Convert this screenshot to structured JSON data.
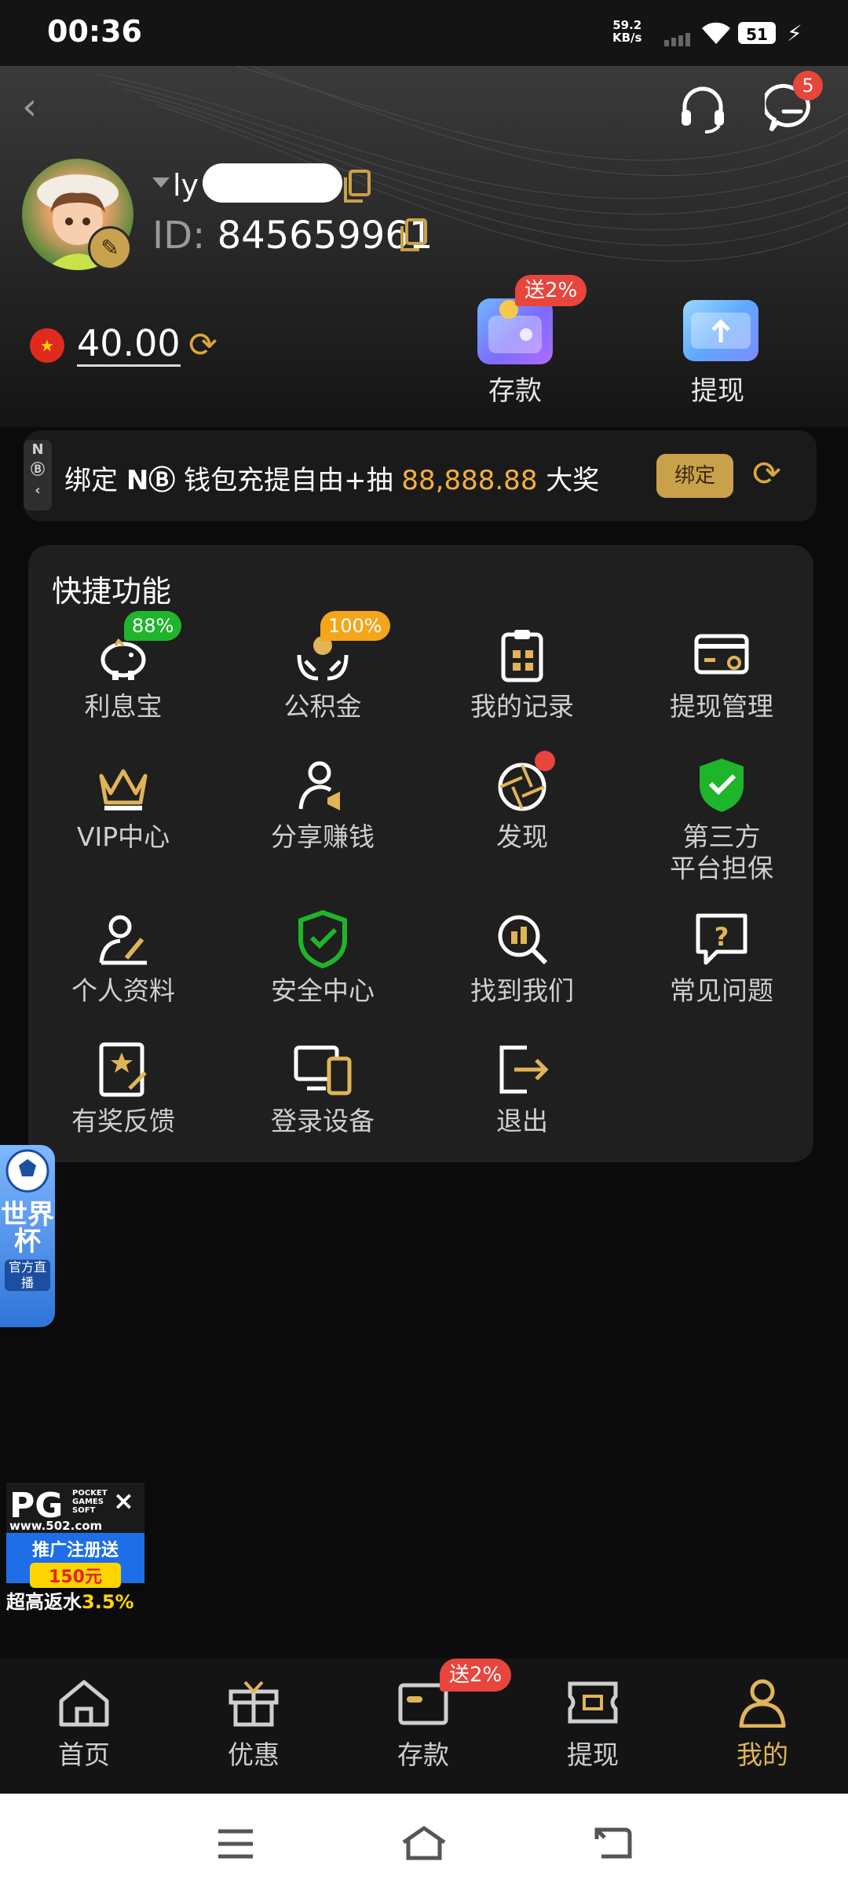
{
  "status_bar": {
    "time": "00:36",
    "net_speed_value": "59.2",
    "net_speed_unit": "KB/s",
    "battery": "51"
  },
  "header": {
    "message_badge": "5",
    "username_visible": "ly",
    "id_label": "ID:",
    "id_value": "845659961",
    "balance": "40.00",
    "deposit_badge": "送2%",
    "deposit_label": "存款",
    "withdraw_label": "提现"
  },
  "bind_banner": {
    "tab_text": "N",
    "text_prefix": "绑定",
    "brand": "N",
    "text_middle": "钱包充提自由+抽",
    "amount": "88,888.88",
    "text_suffix": "大奖",
    "button_label": "绑定"
  },
  "quick_functions": {
    "title": "快捷功能",
    "items": [
      {
        "label": "利息宝",
        "icon": "piggy-bank-icon",
        "badge": "88%"
      },
      {
        "label": "公积金",
        "icon": "coin-hands-icon",
        "badge": "100%"
      },
      {
        "label": "我的记录",
        "icon": "clipboard-icon"
      },
      {
        "label": "提现管理",
        "icon": "card-settings-icon"
      },
      {
        "label": "VIP中心",
        "icon": "crown-icon"
      },
      {
        "label": "分享赚钱",
        "icon": "user-megaphone-icon"
      },
      {
        "label": "发现",
        "icon": "aperture-icon"
      },
      {
        "label": "第三方\n平台担保",
        "label_line1": "第三方",
        "label_line2": "平台担保",
        "icon": "shield-check-icon"
      },
      {
        "label": "个人资料",
        "icon": "user-edit-icon"
      },
      {
        "label": "安全中心",
        "icon": "security-shield-icon"
      },
      {
        "label": "找到我们",
        "icon": "search-building-icon"
      },
      {
        "label": "常见问题",
        "icon": "question-bubble-icon"
      },
      {
        "label": "有奖反馈",
        "icon": "feedback-star-icon"
      },
      {
        "label": "登录设备",
        "icon": "devices-icon"
      },
      {
        "label": "退出",
        "icon": "logout-icon"
      }
    ]
  },
  "floating": {
    "worldcup_text": "世界杯",
    "worldcup_sub": "官方直播",
    "pg_logo": "PG",
    "pg_small": "POCKET GAMES SOFT",
    "pg_url": "www.502.com",
    "pg_promo1": "推广注册送",
    "pg_promo2": "150元",
    "pg_rebate_prefix": "超高返水",
    "pg_rebate_value": "3.5%"
  },
  "bottom_nav": {
    "items": [
      {
        "label": "首页",
        "icon": "home-icon"
      },
      {
        "label": "优惠",
        "icon": "gift-icon"
      },
      {
        "label": "存款",
        "icon": "wallet-icon"
      },
      {
        "label": "提现",
        "icon": "ticket-icon"
      },
      {
        "label": "我的",
        "icon": "person-icon",
        "active": true
      }
    ],
    "deposit_badge": "送2%"
  },
  "colors": {
    "accent_gold": "#e0b457",
    "badge_red": "#e8453c",
    "badge_green": "#1fb52a",
    "badge_orange": "#f5a51a",
    "amount_orange": "#f5b03c"
  }
}
